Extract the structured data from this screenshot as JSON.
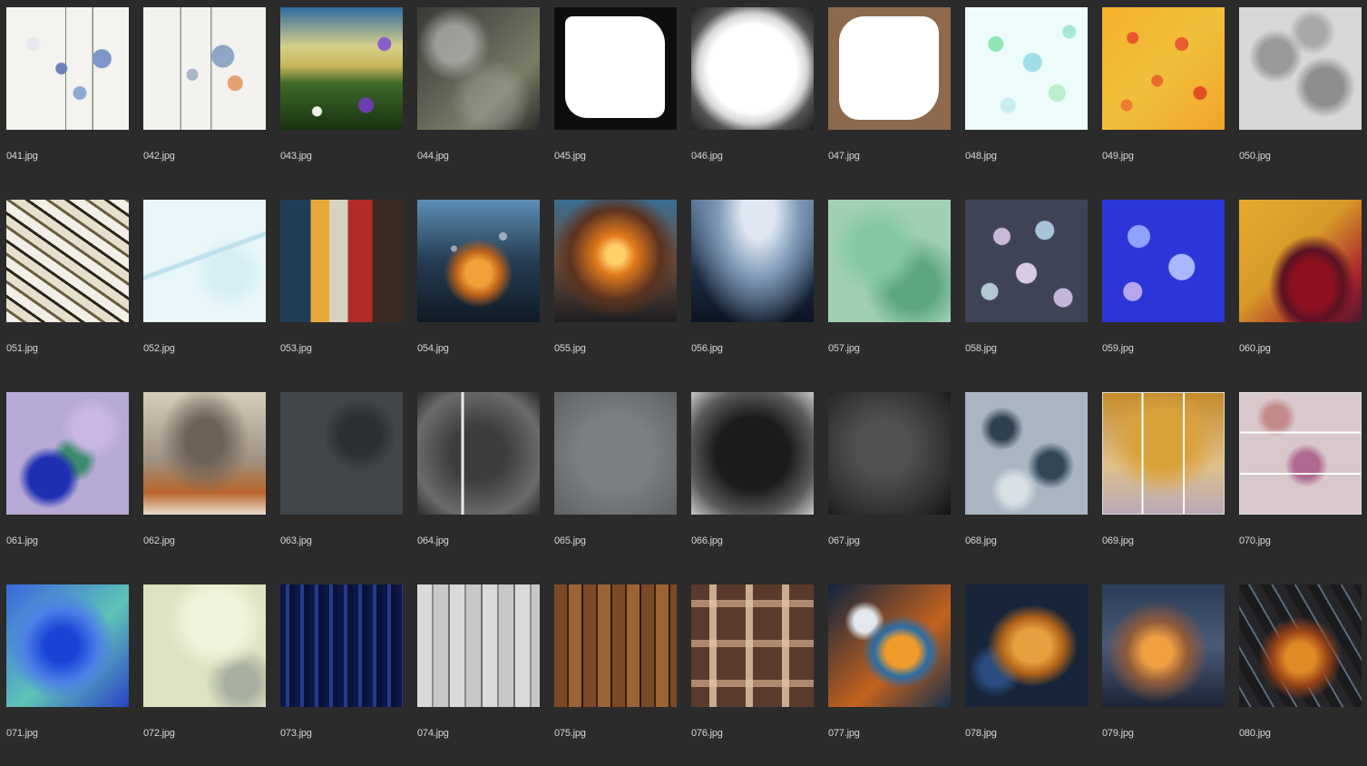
{
  "files": [
    {
      "name": "041.jpg"
    },
    {
      "name": "042.jpg"
    },
    {
      "name": "043.jpg"
    },
    {
      "name": "044.jpg"
    },
    {
      "name": "045.jpg"
    },
    {
      "name": "046.jpg"
    },
    {
      "name": "047.jpg"
    },
    {
      "name": "048.jpg"
    },
    {
      "name": "049.jpg"
    },
    {
      "name": "050.jpg"
    },
    {
      "name": "051.jpg"
    },
    {
      "name": "052.jpg"
    },
    {
      "name": "053.jpg"
    },
    {
      "name": "054.jpg"
    },
    {
      "name": "055.jpg"
    },
    {
      "name": "056.jpg"
    },
    {
      "name": "057.jpg"
    },
    {
      "name": "058.jpg"
    },
    {
      "name": "059.jpg"
    },
    {
      "name": "060.jpg"
    },
    {
      "name": "061.jpg"
    },
    {
      "name": "062.jpg"
    },
    {
      "name": "063.jpg"
    },
    {
      "name": "064.jpg"
    },
    {
      "name": "065.jpg"
    },
    {
      "name": "066.jpg"
    },
    {
      "name": "067.jpg"
    },
    {
      "name": "068.jpg"
    },
    {
      "name": "069.jpg"
    },
    {
      "name": "070.jpg"
    },
    {
      "name": "071.jpg"
    },
    {
      "name": "072.jpg"
    },
    {
      "name": "073.jpg"
    },
    {
      "name": "074.jpg"
    },
    {
      "name": "075.jpg"
    },
    {
      "name": "076.jpg"
    },
    {
      "name": "077.jpg"
    },
    {
      "name": "078.jpg"
    },
    {
      "name": "079.jpg"
    },
    {
      "name": "080.jpg"
    }
  ],
  "colors": {
    "background": "#2b2b2b",
    "label": "#d6d6d6"
  }
}
